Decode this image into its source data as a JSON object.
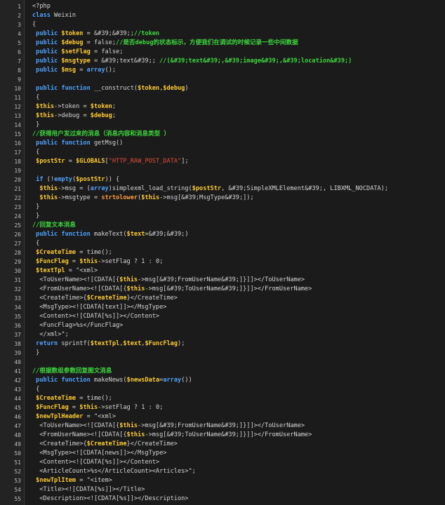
{
  "colors": {
    "background": "#1b1b1b",
    "gutter": "#232323",
    "keyword": "#4fa3ff",
    "variable": "#ffcc33",
    "string": "#e14d3b",
    "comment": "#3ed83e",
    "function": "#ff9c3b",
    "plain": "#d6d6d6"
  },
  "lines": [
    {
      "n": "1",
      "segs": [
        {
          "t": "<?php",
          "c": "ph"
        }
      ]
    },
    {
      "n": "2",
      "segs": [
        {
          "t": "class ",
          "c": "kw"
        },
        {
          "t": "Weixin",
          "c": "pl"
        }
      ]
    },
    {
      "n": "3",
      "segs": [
        {
          "t": "{",
          "c": "pl"
        }
      ]
    },
    {
      "n": "4",
      "segs": [
        {
          "t": " public ",
          "c": "kw"
        },
        {
          "t": "$token",
          "c": "var"
        },
        {
          "t": " = &#39;&#39;;",
          "c": "pl"
        },
        {
          "t": "//token",
          "c": "cmt"
        }
      ]
    },
    {
      "n": "5",
      "segs": [
        {
          "t": " public ",
          "c": "kw"
        },
        {
          "t": "$debug",
          "c": "var"
        },
        {
          "t": " = false;",
          "c": "pl"
        },
        {
          "t": "//是否debug的状态标示，方便我们在调试的时候记录一些中间数据",
          "c": "cmt"
        }
      ]
    },
    {
      "n": "6",
      "segs": [
        {
          "t": " public ",
          "c": "kw"
        },
        {
          "t": "$setFlag",
          "c": "var"
        },
        {
          "t": " = false;",
          "c": "pl"
        }
      ]
    },
    {
      "n": "7",
      "segs": [
        {
          "t": " public ",
          "c": "kw"
        },
        {
          "t": "$msgtype",
          "c": "var"
        },
        {
          "t": " = &#39;text&#39;; ",
          "c": "pl"
        },
        {
          "t": "//(&#39;text&#39;,&#39;image&#39;,&#39;location&#39;)",
          "c": "cmt"
        }
      ]
    },
    {
      "n": "8",
      "segs": [
        {
          "t": " public ",
          "c": "kw"
        },
        {
          "t": "$msg",
          "c": "var"
        },
        {
          "t": " = ",
          "c": "pl"
        },
        {
          "t": "array",
          "c": "kw"
        },
        {
          "t": "();",
          "c": "pl"
        }
      ]
    },
    {
      "n": "9",
      "segs": []
    },
    {
      "n": "10",
      "segs": [
        {
          "t": " public function ",
          "c": "kw"
        },
        {
          "t": "__construct(",
          "c": "pl"
        },
        {
          "t": "$token",
          "c": "var"
        },
        {
          "t": ",",
          "c": "pl"
        },
        {
          "t": "$debug",
          "c": "var"
        },
        {
          "t": ")",
          "c": "pl"
        }
      ]
    },
    {
      "n": "11",
      "segs": [
        {
          "t": " {",
          "c": "pl"
        }
      ]
    },
    {
      "n": "12",
      "segs": [
        {
          "t": " $this",
          "c": "var"
        },
        {
          "t": "->token = ",
          "c": "pl"
        },
        {
          "t": "$token",
          "c": "var"
        },
        {
          "t": ";",
          "c": "pl"
        }
      ]
    },
    {
      "n": "13",
      "segs": [
        {
          "t": " $this",
          "c": "var"
        },
        {
          "t": "->debug = ",
          "c": "pl"
        },
        {
          "t": "$debug",
          "c": "var"
        },
        {
          "t": ";",
          "c": "pl"
        }
      ]
    },
    {
      "n": "14",
      "segs": [
        {
          "t": " }",
          "c": "pl"
        }
      ]
    },
    {
      "n": "15",
      "segs": [
        {
          "t": "//获得用户发过来的消息（消息内容和消息类型 ）",
          "c": "cmt"
        }
      ]
    },
    {
      "n": "16",
      "segs": [
        {
          "t": " public function ",
          "c": "kw"
        },
        {
          "t": "getMsg()",
          "c": "pl"
        }
      ]
    },
    {
      "n": "17",
      "segs": [
        {
          "t": " {",
          "c": "pl"
        }
      ]
    },
    {
      "n": "18",
      "segs": [
        {
          "t": " $postStr",
          "c": "var"
        },
        {
          "t": " = ",
          "c": "pl"
        },
        {
          "t": "$GLOBALS",
          "c": "var"
        },
        {
          "t": "[",
          "c": "pl"
        },
        {
          "t": "\"HTTP_RAW_POST_DATA\"",
          "c": "str"
        },
        {
          "t": "];",
          "c": "pl"
        }
      ]
    },
    {
      "n": "19",
      "segs": []
    },
    {
      "n": "20",
      "segs": [
        {
          "t": " if ",
          "c": "kw"
        },
        {
          "t": "(!",
          "c": "pl"
        },
        {
          "t": "empty",
          "c": "kw"
        },
        {
          "t": "(",
          "c": "pl"
        },
        {
          "t": "$postStr",
          "c": "var"
        },
        {
          "t": ")) {",
          "c": "pl"
        }
      ]
    },
    {
      "n": "21",
      "segs": [
        {
          "t": "  $this",
          "c": "var"
        },
        {
          "t": "->msg = (",
          "c": "pl"
        },
        {
          "t": "array",
          "c": "kw"
        },
        {
          "t": ")simplexml_load_string(",
          "c": "pl"
        },
        {
          "t": "$postStr",
          "c": "var"
        },
        {
          "t": ", &#39;SimpleXMLElement&#39;, LIBXML_NOCDATA);",
          "c": "pl"
        }
      ]
    },
    {
      "n": "22",
      "segs": [
        {
          "t": "  $this",
          "c": "var"
        },
        {
          "t": "->msgtype = ",
          "c": "pl"
        },
        {
          "t": "strtolower",
          "c": "fn"
        },
        {
          "t": "(",
          "c": "pl"
        },
        {
          "t": "$this",
          "c": "var"
        },
        {
          "t": "->msg[&#39;MsgType&#39;]);",
          "c": "pl"
        }
      ]
    },
    {
      "n": "23",
      "segs": [
        {
          "t": " }",
          "c": "pl"
        }
      ]
    },
    {
      "n": "24",
      "segs": [
        {
          "t": " }",
          "c": "pl"
        }
      ]
    },
    {
      "n": "25",
      "segs": [
        {
          "t": "//回复文本消息",
          "c": "cmt"
        }
      ]
    },
    {
      "n": "26",
      "segs": [
        {
          "t": " public function ",
          "c": "kw"
        },
        {
          "t": "makeText(",
          "c": "pl"
        },
        {
          "t": "$text",
          "c": "var"
        },
        {
          "t": "=&#39;&#39;)",
          "c": "pl"
        }
      ]
    },
    {
      "n": "27",
      "segs": [
        {
          "t": " {",
          "c": "pl"
        }
      ]
    },
    {
      "n": "28",
      "segs": [
        {
          "t": " $CreateTime",
          "c": "var"
        },
        {
          "t": " = time();",
          "c": "pl"
        }
      ]
    },
    {
      "n": "29",
      "segs": [
        {
          "t": " $FuncFlag",
          "c": "var"
        },
        {
          "t": " = ",
          "c": "pl"
        },
        {
          "t": "$this",
          "c": "var"
        },
        {
          "t": "->setFlag ? 1 : 0;",
          "c": "pl"
        }
      ]
    },
    {
      "n": "30",
      "segs": [
        {
          "t": " $textTpl",
          "c": "var"
        },
        {
          "t": " = \"<xml>",
          "c": "pl"
        }
      ]
    },
    {
      "n": "31",
      "segs": [
        {
          "t": "  <ToUserName><![CDATA[{",
          "c": "pl"
        },
        {
          "t": "$this",
          "c": "var"
        },
        {
          "t": "->msg[&#39;FromUserName&#39;]}]]></ToUserName>",
          "c": "pl"
        }
      ]
    },
    {
      "n": "32",
      "segs": [
        {
          "t": "  <FromUserName><![CDATA[{",
          "c": "pl"
        },
        {
          "t": "$this",
          "c": "var"
        },
        {
          "t": "->msg[&#39;ToUserName&#39;]}]]></FromUserName>",
          "c": "pl"
        }
      ]
    },
    {
      "n": "33",
      "segs": [
        {
          "t": "  <CreateTime>{",
          "c": "pl"
        },
        {
          "t": "$CreateTime",
          "c": "var"
        },
        {
          "t": "}</CreateTime>",
          "c": "pl"
        }
      ]
    },
    {
      "n": "34",
      "segs": [
        {
          "t": "  <MsgType><![CDATA[text]]></MsgType>",
          "c": "pl"
        }
      ]
    },
    {
      "n": "35",
      "segs": [
        {
          "t": "  <Content><![CDATA[%s]]></Content>",
          "c": "pl"
        }
      ]
    },
    {
      "n": "36",
      "segs": [
        {
          "t": "  <FuncFlag>%s</FuncFlag>",
          "c": "pl"
        }
      ]
    },
    {
      "n": "37",
      "segs": [
        {
          "t": "  </xml>\";",
          "c": "pl"
        }
      ]
    },
    {
      "n": "38",
      "segs": [
        {
          "t": " return ",
          "c": "kw"
        },
        {
          "t": "sprintf(",
          "c": "pl"
        },
        {
          "t": "$textTpl",
          "c": "var"
        },
        {
          "t": ",",
          "c": "pl"
        },
        {
          "t": "$text",
          "c": "var"
        },
        {
          "t": ",",
          "c": "pl"
        },
        {
          "t": "$FuncFlag",
          "c": "var"
        },
        {
          "t": ");",
          "c": "pl"
        }
      ]
    },
    {
      "n": "39",
      "segs": [
        {
          "t": " }",
          "c": "pl"
        }
      ]
    },
    {
      "n": "40",
      "segs": []
    },
    {
      "n": "41",
      "segs": [
        {
          "t": "//根据数组参数回复图文消息",
          "c": "cmt"
        }
      ]
    },
    {
      "n": "42",
      "segs": [
        {
          "t": " public function ",
          "c": "kw"
        },
        {
          "t": "makeNews(",
          "c": "pl"
        },
        {
          "t": "$newsData",
          "c": "var"
        },
        {
          "t": "=",
          "c": "pl"
        },
        {
          "t": "array",
          "c": "kw"
        },
        {
          "t": "())",
          "c": "pl"
        }
      ]
    },
    {
      "n": "43",
      "segs": [
        {
          "t": " {",
          "c": "pl"
        }
      ]
    },
    {
      "n": "44",
      "segs": [
        {
          "t": " $CreateTime",
          "c": "var"
        },
        {
          "t": " = time();",
          "c": "pl"
        }
      ]
    },
    {
      "n": "45",
      "segs": [
        {
          "t": " $FuncFlag",
          "c": "var"
        },
        {
          "t": " = ",
          "c": "pl"
        },
        {
          "t": "$this",
          "c": "var"
        },
        {
          "t": "->setFlag ? 1 : 0;",
          "c": "pl"
        }
      ]
    },
    {
      "n": "46",
      "segs": [
        {
          "t": " $newTplHeader",
          "c": "var"
        },
        {
          "t": " = \"<xml>",
          "c": "pl"
        }
      ]
    },
    {
      "n": "47",
      "segs": [
        {
          "t": "  <ToUserName><![CDATA[{",
          "c": "pl"
        },
        {
          "t": "$this",
          "c": "var"
        },
        {
          "t": "->msg[&#39;FromUserName&#39;]}]]></ToUserName>",
          "c": "pl"
        }
      ]
    },
    {
      "n": "48",
      "segs": [
        {
          "t": "  <FromUserName><![CDATA[{",
          "c": "pl"
        },
        {
          "t": "$this",
          "c": "var"
        },
        {
          "t": "->msg[&#39;ToUserName&#39;]}]]></FromUserName>",
          "c": "pl"
        }
      ]
    },
    {
      "n": "49",
      "segs": [
        {
          "t": "  <CreateTime>{",
          "c": "pl"
        },
        {
          "t": "$CreateTime",
          "c": "var"
        },
        {
          "t": "}</CreateTime>",
          "c": "pl"
        }
      ]
    },
    {
      "n": "50",
      "segs": [
        {
          "t": "  <MsgType><![CDATA[news]]></MsgType>",
          "c": "pl"
        }
      ]
    },
    {
      "n": "51",
      "segs": [
        {
          "t": "  <Content><![CDATA[%s]]></Content>",
          "c": "pl"
        }
      ]
    },
    {
      "n": "52",
      "segs": [
        {
          "t": "  <ArticleCount>%s</ArticleCount><Articles>\";",
          "c": "pl"
        }
      ]
    },
    {
      "n": "53",
      "segs": [
        {
          "t": " $newTplItem",
          "c": "var"
        },
        {
          "t": " = \"<item>",
          "c": "pl"
        }
      ]
    },
    {
      "n": "54",
      "segs": [
        {
          "t": "  <Title><![CDATA[%s]]></Title>",
          "c": "pl"
        }
      ]
    },
    {
      "n": "55",
      "segs": [
        {
          "t": "  <Description><![CDATA[%s]]></Description>",
          "c": "pl"
        }
      ]
    }
  ]
}
